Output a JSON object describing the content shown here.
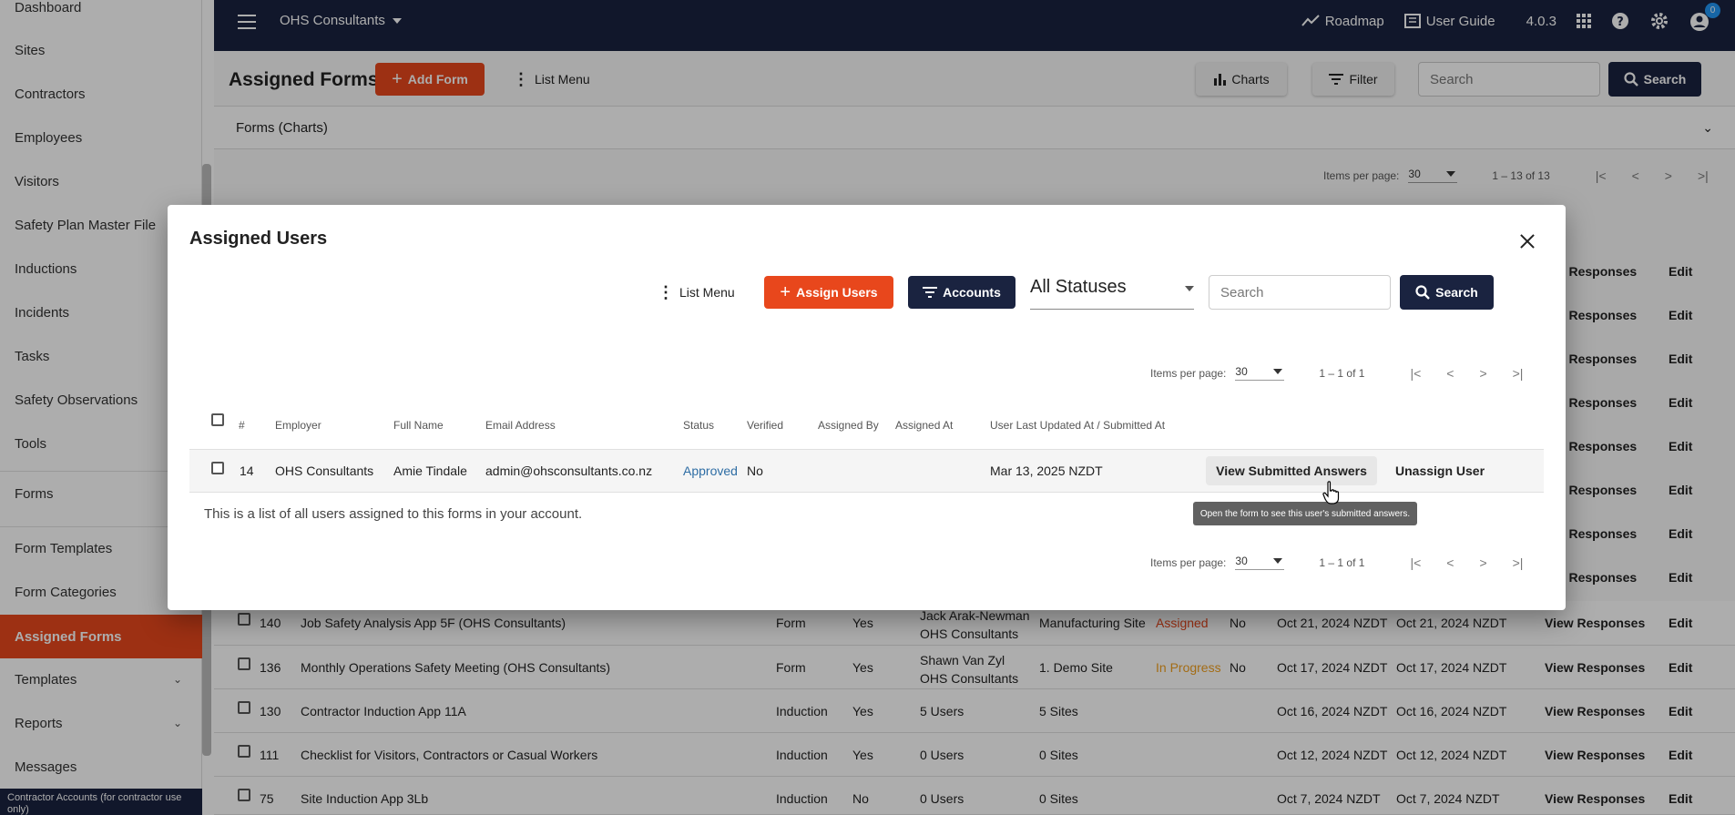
{
  "sidebar": {
    "items": [
      {
        "label": "Dashboard"
      },
      {
        "label": "Sites"
      },
      {
        "label": "Contractors"
      },
      {
        "label": "Employees"
      },
      {
        "label": "Visitors"
      },
      {
        "label": "Safety Plan Master File"
      },
      {
        "label": "Inductions"
      },
      {
        "label": "Incidents"
      },
      {
        "label": "Tasks"
      },
      {
        "label": "Safety Observations"
      },
      {
        "label": "Tools"
      },
      {
        "label": "Forms"
      },
      {
        "label": "Form Templates"
      },
      {
        "label": "Form Categories"
      },
      {
        "label": "Assigned Forms"
      },
      {
        "label": "Templates"
      },
      {
        "label": "Reports"
      },
      {
        "label": "Messages"
      }
    ],
    "contractor_box": "Contractor Accounts (for contractor use only)"
  },
  "topbar": {
    "account": "OHS Consultants",
    "roadmap": "Roadmap",
    "user_guide": "User Guide",
    "version": "4.0.3",
    "notification_count": "0"
  },
  "page": {
    "title": "Assigned Forms",
    "add_form": "Add Form",
    "list_menu": "List Menu",
    "charts": "Charts",
    "filter": "Filter",
    "search_placeholder": "Search",
    "search_button": "Search",
    "accordion": "Forms (Charts)",
    "paginator": {
      "label": "Items per page:",
      "value": "30",
      "range": "1 – 13 of 13"
    }
  },
  "background_rows": [
    {
      "id": "140",
      "name": "Job Safety Analysis App 5F (OHS Consultants)",
      "type": "Form",
      "yes": "Yes",
      "assigned_user": "Jack Arak-Newman",
      "assigned_org": "OHS Consultants",
      "site": "Manufacturing Site",
      "status": "Assigned",
      "verified": "No",
      "d1": "Oct 21, 2024 NZDT",
      "d2": "Oct 21, 2024 NZDT"
    },
    {
      "id": "136",
      "name": "Monthly Operations Safety Meeting (OHS Consultants)",
      "type": "Form",
      "yes": "Yes",
      "assigned_user": "Shawn Van Zyl",
      "assigned_org": "OHS Consultants",
      "site": "1. Demo Site",
      "status": "In Progress",
      "verified": "No",
      "d1": "Oct 17, 2024 NZDT",
      "d2": "Oct 17, 2024 NZDT"
    },
    {
      "id": "130",
      "name": "Contractor Induction App 11A",
      "type": "Induction",
      "yes": "Yes",
      "assigned_user": "5 Users",
      "assigned_org": "",
      "site": "5 Sites",
      "status": "",
      "verified": "",
      "d1": "Oct 16, 2024 NZDT",
      "d2": "Oct 16, 2024 NZDT"
    },
    {
      "id": "111",
      "name": "Checklist for Visitors, Contractors or Casual Workers",
      "type": "Induction",
      "yes": "Yes",
      "assigned_user": "0 Users",
      "assigned_org": "",
      "site": "0 Sites",
      "status": "",
      "verified": "",
      "d1": "Oct 12, 2024 NZDT",
      "d2": "Oct 12, 2024 NZDT"
    },
    {
      "id": "75",
      "name": "Site Induction App 3Lb",
      "type": "Induction",
      "yes": "No",
      "assigned_user": "0 Users",
      "assigned_org": "",
      "site": "0 Sites",
      "status": "",
      "verified": "",
      "d1": "Oct 7, 2024 NZDT",
      "d2": "Oct 7, 2024 NZDT"
    }
  ],
  "row_actions": {
    "view": "View Responses",
    "view_partial": "iew Responses",
    "edit": "Edit"
  },
  "dialog": {
    "title": "Assigned Users",
    "list_menu": "List Menu",
    "assign_users": "Assign Users",
    "accounts": "Accounts",
    "status_select": "All Statuses",
    "search_placeholder": "Search",
    "search_button": "Search",
    "paginator": {
      "label": "Items per page:",
      "value": "30",
      "range": "1 – 1 of 1"
    },
    "columns": [
      "#",
      "Employer",
      "Full Name",
      "Email Address",
      "Status",
      "Verified",
      "Assigned By",
      "Assigned At",
      "User Last Updated At / Submitted At"
    ],
    "row": {
      "id": "14",
      "employer": "OHS Consultants",
      "full_name": "Amie Tindale",
      "email": "admin@ohsconsultants.co.nz",
      "status": "Approved",
      "verified": "No",
      "assigned_by": "",
      "assigned_at": "",
      "updated": "Mar 13, 2025 NZDT",
      "view_answers": "View Submitted Answers",
      "unassign": "Unassign User"
    },
    "tooltip": "Open the form to see this user's submitted answers.",
    "note": "This is a list of all users assigned to this forms in your account."
  }
}
